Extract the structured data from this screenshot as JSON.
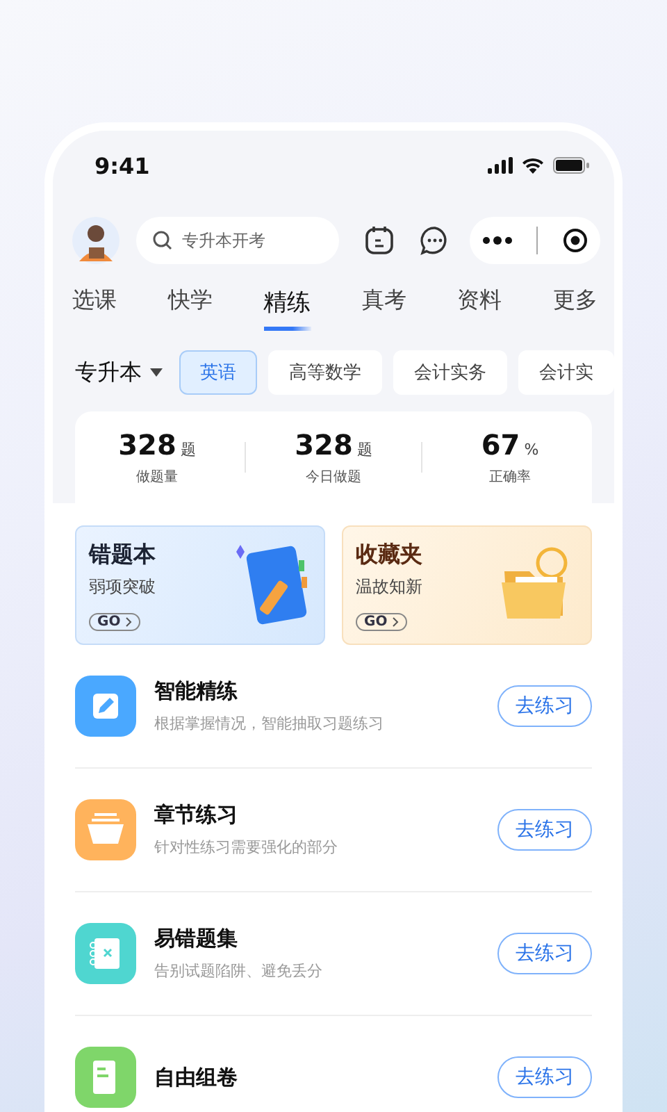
{
  "status_bar": {
    "time": "9:41"
  },
  "search": {
    "placeholder": "专升本开考"
  },
  "tabs": [
    {
      "label": "选课",
      "selected": false
    },
    {
      "label": "快学",
      "selected": false
    },
    {
      "label": "精练",
      "selected": true
    },
    {
      "label": "真考",
      "selected": false
    },
    {
      "label": "资料",
      "selected": false
    },
    {
      "label": "更多",
      "selected": false
    }
  ],
  "level_selector": {
    "label": "专升本"
  },
  "subjects": [
    {
      "label": "英语",
      "selected": true
    },
    {
      "label": "高等数学",
      "selected": false
    },
    {
      "label": "会计实务",
      "selected": false
    },
    {
      "label": "会计实",
      "selected": false
    }
  ],
  "stats": [
    {
      "value": "328",
      "unit": "题",
      "label": "做题量"
    },
    {
      "value": "328",
      "unit": "题",
      "label": "今日做题"
    },
    {
      "value": "67",
      "unit": "%",
      "label": "正确率"
    }
  ],
  "cards": [
    {
      "kind": "notebook",
      "title": "错题本",
      "subtitle": "弱项突破",
      "action": "GO"
    },
    {
      "kind": "folder",
      "title": "收藏夹",
      "subtitle": "温故知新",
      "action": "GO"
    }
  ],
  "practice_items": [
    {
      "kind": "pencil",
      "color": "#4aa8ff",
      "title": "智能精练",
      "subtitle": "根据掌握情况，智能抽取习题练习",
      "button": "去练习"
    },
    {
      "kind": "basket",
      "color": "#ffb35c",
      "title": "章节练习",
      "subtitle": "针对性练习需要强化的部分",
      "button": "去练习"
    },
    {
      "kind": "binder",
      "color": "#4fd6d0",
      "title": "易错题集",
      "subtitle": "告别试题陷阱、避免丢分",
      "button": "去练习"
    },
    {
      "kind": "sheet",
      "color": "#7fd66a",
      "title": "自由组卷",
      "button": "去练习"
    }
  ]
}
